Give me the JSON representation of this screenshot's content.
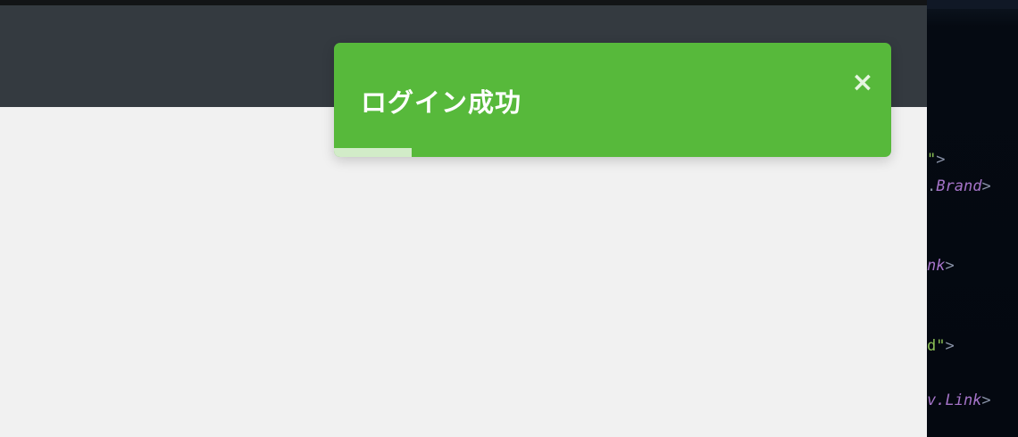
{
  "toast": {
    "message": "ログイン成功",
    "close_label": "×",
    "progress": 0.14,
    "background_color": "#57b93b"
  },
  "navbar": {
    "background_color": "#343a40"
  },
  "page": {
    "background_color": "#f1f1f1"
  },
  "code_editor": {
    "lines": [
      {
        "str": "\"",
        "punct": ">",
        "tag": ""
      },
      {
        "str": "",
        "punct": ".",
        "tag": "Brand",
        "suffix": ">"
      },
      {
        "str": "",
        "punct": "",
        "tag": "nk",
        "suffix": ">"
      },
      {
        "str": "d\"",
        "punct": ">",
        "tag": ""
      },
      {
        "str": "",
        "punct": "",
        "tag": "v.Link",
        "suffix": ">"
      }
    ]
  },
  "icons": {
    "close": "close-icon"
  }
}
